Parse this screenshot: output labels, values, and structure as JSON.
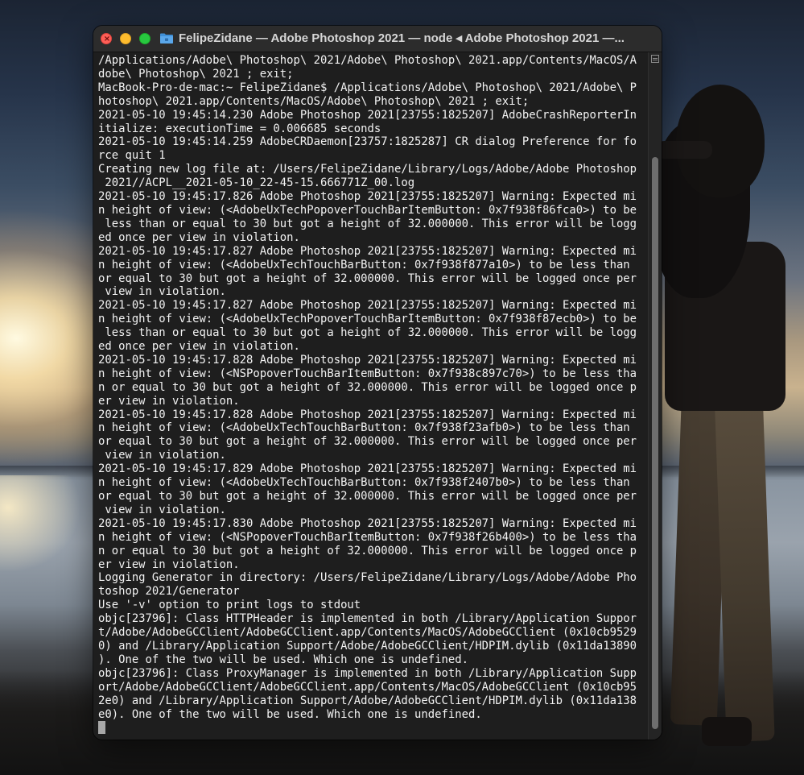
{
  "window": {
    "title": "FelipeZidane — Adobe Photoshop 2021 — node ◂ Adobe Photoshop 2021 —...",
    "close_glyph": "×",
    "folder_icon_color": "#3f8fd6"
  },
  "terminal": {
    "lines": [
      "/Applications/Adobe\\ Photoshop\\ 2021/Adobe\\ Photoshop\\ 2021.app/Contents/MacOS/A",
      "dobe\\ Photoshop\\ 2021 ; exit;",
      "MacBook-Pro-de-mac:~ FelipeZidane$ /Applications/Adobe\\ Photoshop\\ 2021/Adobe\\ P",
      "hotoshop\\ 2021.app/Contents/MacOS/Adobe\\ Photoshop\\ 2021 ; exit;",
      "2021-05-10 19:45:14.230 Adobe Photoshop 2021[23755:1825207] AdobeCrashReporterIn",
      "itialize: executionTime = 0.006685 seconds",
      "2021-05-10 19:45:14.259 AdobeCRDaemon[23757:1825287] CR dialog Preference for fo",
      "rce quit 1",
      "Creating new log file at: /Users/FelipeZidane/Library/Logs/Adobe/Adobe Photoshop",
      " 2021//ACPL__2021-05-10_22-45-15.666771Z_00.log",
      "2021-05-10 19:45:17.826 Adobe Photoshop 2021[23755:1825207] Warning: Expected mi",
      "n height of view: (<AdobeUxTechPopoverTouchBarItemButton: 0x7f938f86fca0>) to be",
      " less than or equal to 30 but got a height of 32.000000. This error will be logg",
      "ed once per view in violation.",
      "2021-05-10 19:45:17.827 Adobe Photoshop 2021[23755:1825207] Warning: Expected mi",
      "n height of view: (<AdobeUxTechTouchBarButton: 0x7f938f877a10>) to be less than",
      "or equal to 30 but got a height of 32.000000. This error will be logged once per",
      " view in violation.",
      "2021-05-10 19:45:17.827 Adobe Photoshop 2021[23755:1825207] Warning: Expected mi",
      "n height of view: (<AdobeUxTechPopoverTouchBarItemButton: 0x7f938f87ecb0>) to be",
      " less than or equal to 30 but got a height of 32.000000. This error will be logg",
      "ed once per view in violation.",
      "2021-05-10 19:45:17.828 Adobe Photoshop 2021[23755:1825207] Warning: Expected mi",
      "n height of view: (<NSPopoverTouchBarItemButton: 0x7f938c897c70>) to be less tha",
      "n or equal to 30 but got a height of 32.000000. This error will be logged once p",
      "er view in violation.",
      "2021-05-10 19:45:17.828 Adobe Photoshop 2021[23755:1825207] Warning: Expected mi",
      "n height of view: (<AdobeUxTechTouchBarButton: 0x7f938f23afb0>) to be less than",
      "or equal to 30 but got a height of 32.000000. This error will be logged once per",
      " view in violation.",
      "2021-05-10 19:45:17.829 Adobe Photoshop 2021[23755:1825207] Warning: Expected mi",
      "n height of view: (<AdobeUxTechTouchBarButton: 0x7f938f2407b0>) to be less than",
      "or equal to 30 but got a height of 32.000000. This error will be logged once per",
      " view in violation.",
      "2021-05-10 19:45:17.830 Adobe Photoshop 2021[23755:1825207] Warning: Expected mi",
      "n height of view: (<NSPopoverTouchBarItemButton: 0x7f938f26b400>) to be less tha",
      "n or equal to 30 but got a height of 32.000000. This error will be logged once p",
      "er view in violation.",
      "Logging Generator in directory: /Users/FelipeZidane/Library/Logs/Adobe/Adobe Pho",
      "toshop 2021/Generator",
      "Use '-v' option to print logs to stdout",
      "objc[23796]: Class HTTPHeader is implemented in both /Library/Application Suppor",
      "t/Adobe/AdobeGCClient/AdobeGCClient.app/Contents/MacOS/AdobeGCClient (0x10cb9529",
      "0) and /Library/Application Support/Adobe/AdobeGCClient/HDPIM.dylib (0x11da13890",
      "). One of the two will be used. Which one is undefined.",
      "objc[23796]: Class ProxyManager is implemented in both /Library/Application Supp",
      "ort/Adobe/AdobeGCClient/AdobeGCClient.app/Contents/MacOS/AdobeGCClient (0x10cb95",
      "2e0) and /Library/Application Support/Adobe/AdobeGCClient/HDPIM.dylib (0x11da138",
      "e0). One of the two will be used. Which one is undefined."
    ],
    "text_color": "#f2f2f2",
    "background_color": "#1e1e1e"
  }
}
